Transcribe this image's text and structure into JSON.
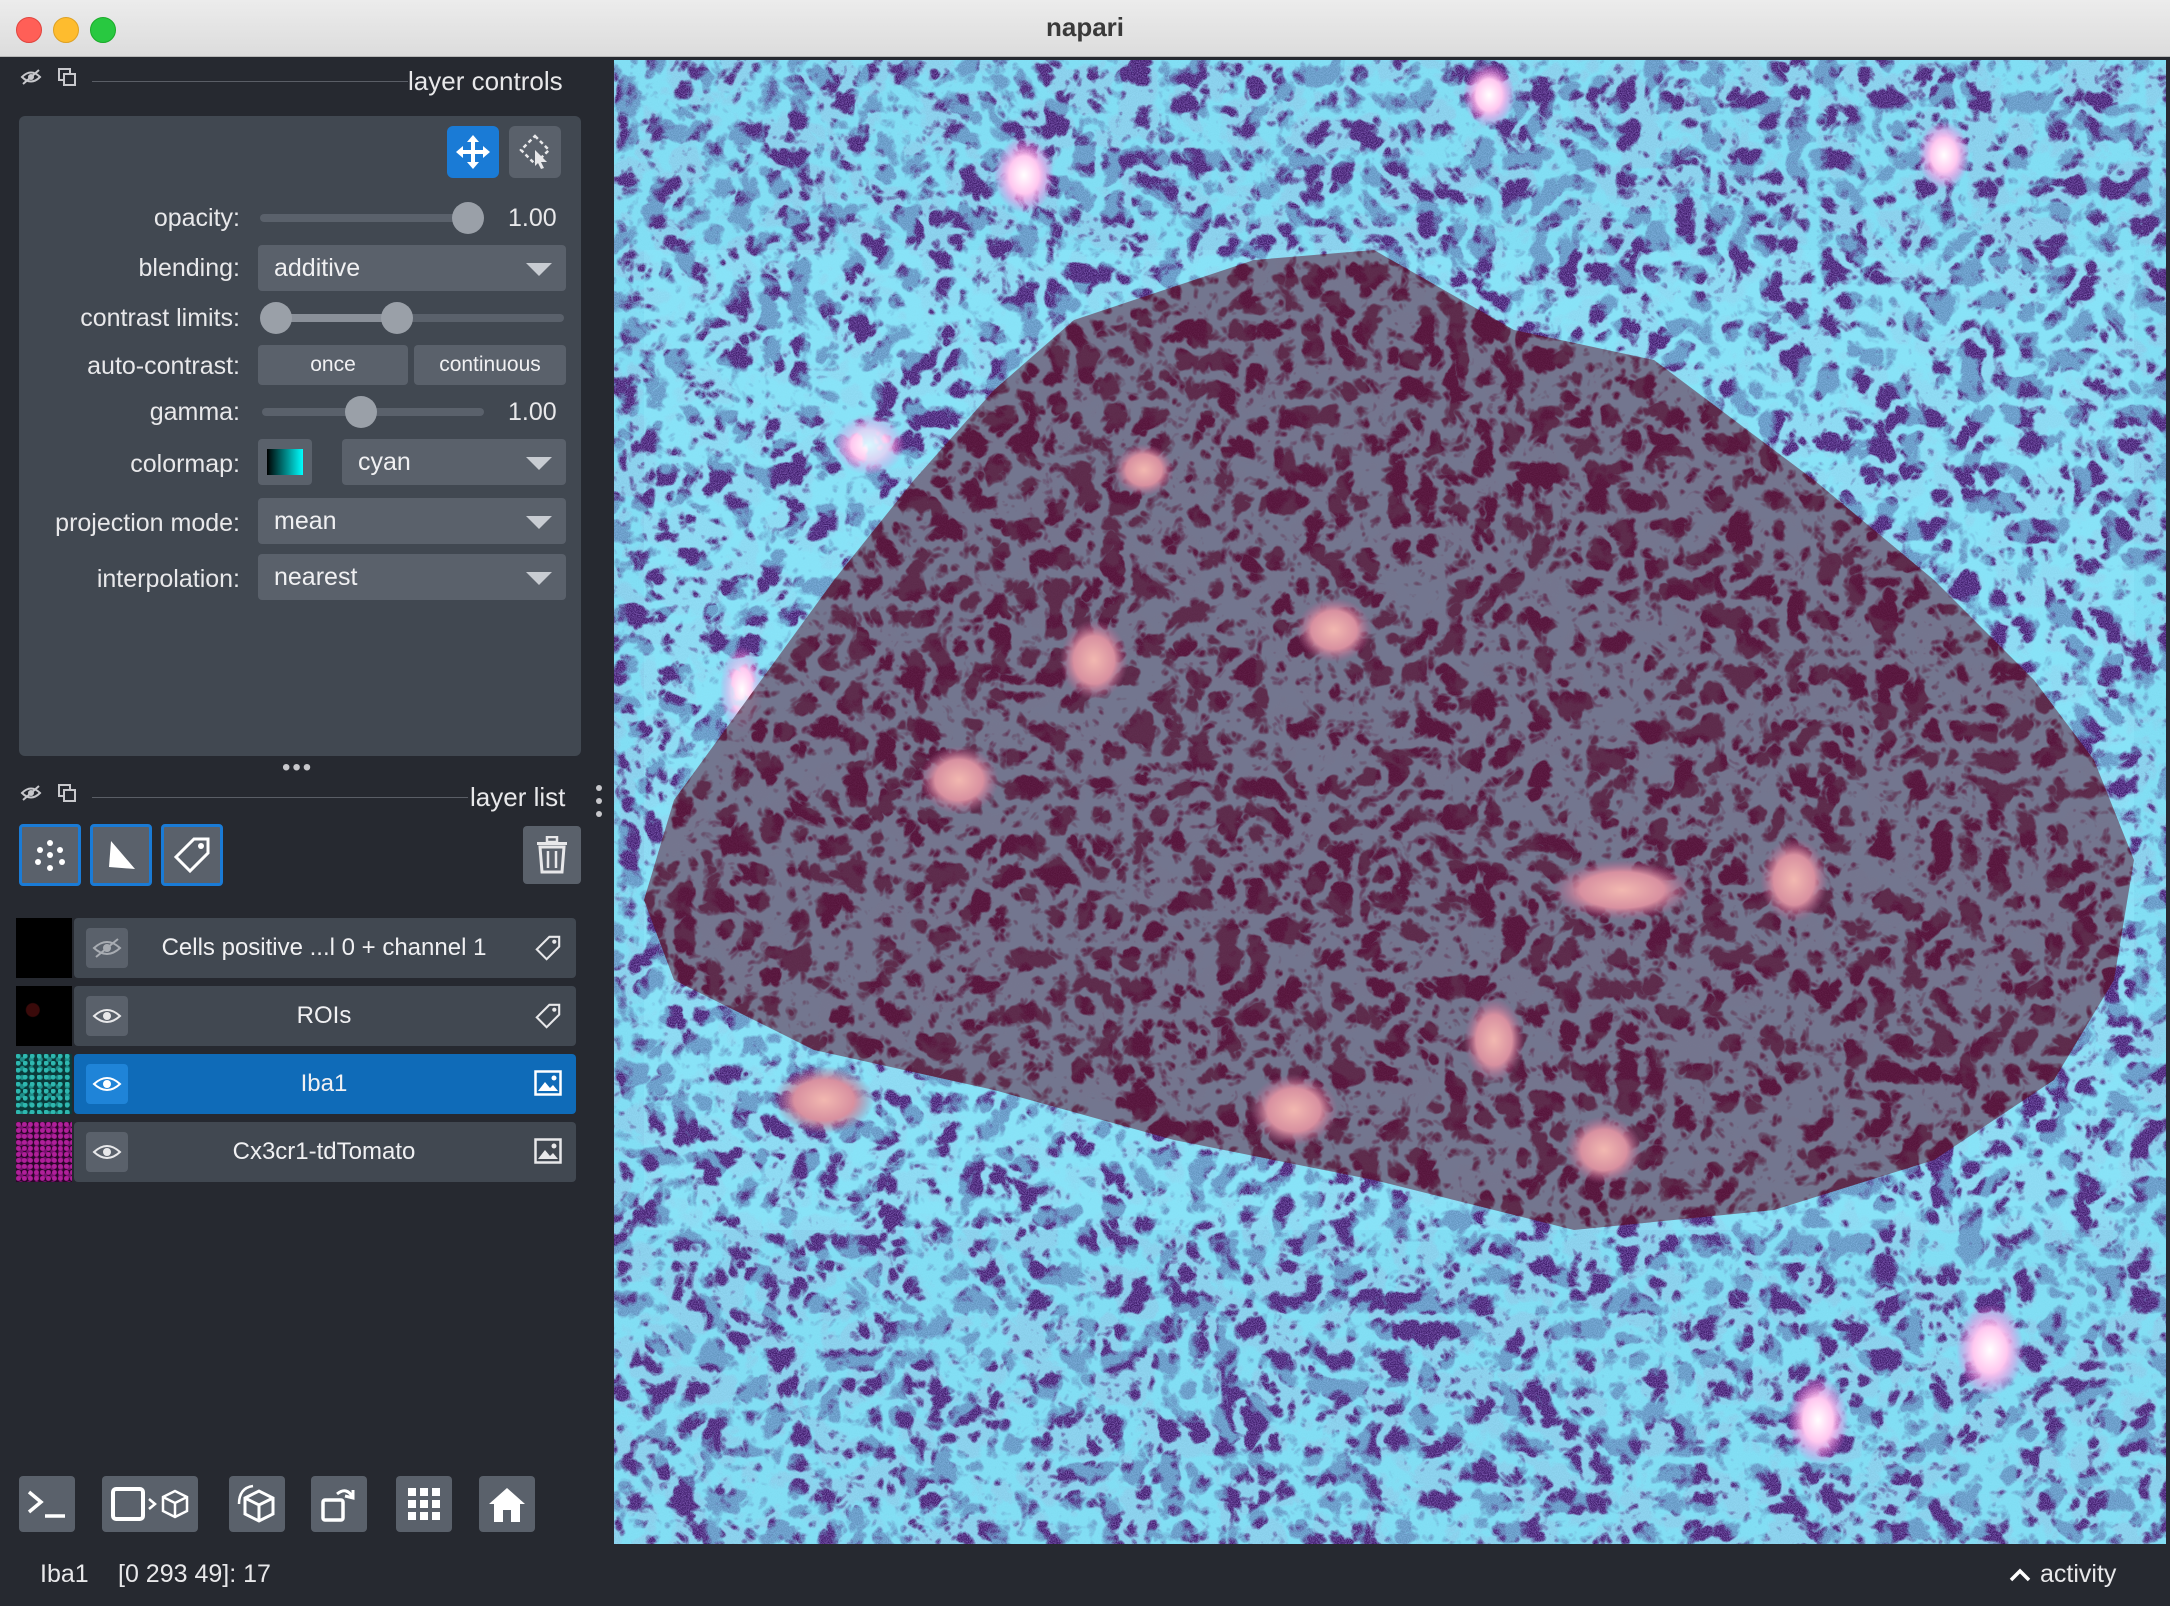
{
  "window": {
    "title": "napari"
  },
  "layer_controls": {
    "header_label": "layer controls",
    "opacity": {
      "label": "opacity:",
      "value": "1.00",
      "level": 1.0
    },
    "blending": {
      "label": "blending:",
      "value": "additive"
    },
    "contrast_limits": {
      "label": "contrast limits:"
    },
    "auto_contrast": {
      "label": "auto-contrast:",
      "once": "once",
      "continuous": "continuous"
    },
    "gamma": {
      "label": "gamma:",
      "value": "1.00"
    },
    "colormap": {
      "label": "colormap:",
      "value": "cyan"
    },
    "projection_mode": {
      "label": "projection mode:",
      "value": "mean"
    },
    "interpolation": {
      "label": "interpolation:",
      "value": "nearest"
    }
  },
  "layer_list": {
    "header_label": "layer list",
    "layers": [
      {
        "name": "Cells positive ...l 0 + channel 1",
        "type_icon": "label-tag-icon",
        "visible": false,
        "selected": false
      },
      {
        "name": "ROIs",
        "type_icon": "label-tag-icon",
        "visible": true,
        "selected": false
      },
      {
        "name": "Iba1",
        "type_icon": "image-icon",
        "visible": true,
        "selected": true
      },
      {
        "name": "Cx3cr1-tdTomato",
        "type_icon": "image-icon",
        "visible": true,
        "selected": false
      }
    ]
  },
  "status_bar": {
    "layer": "Iba1",
    "coords": "[0 293 49]: 17",
    "activity": "activity"
  },
  "colors": {
    "accent": "#1a7bd6",
    "panel_bg": "#262930",
    "control_bg": "#414851",
    "selected_layer": "#0f6bb8"
  }
}
